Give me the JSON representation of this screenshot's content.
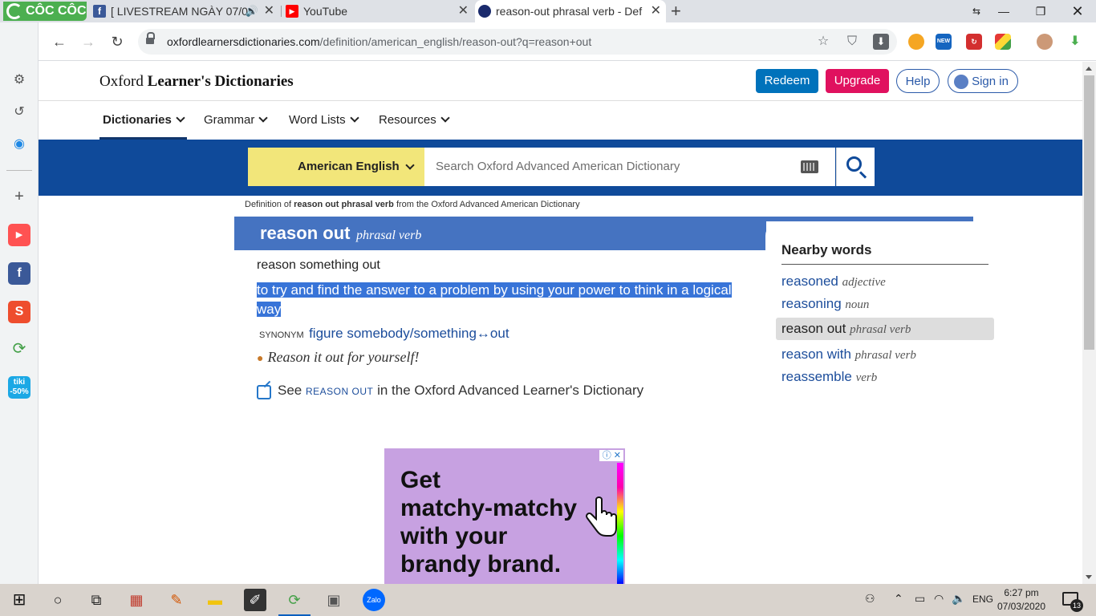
{
  "browser": {
    "brand": "CÔC CÔC",
    "tabs": [
      {
        "title": "[ LIVESTREAM NGÀY 07/0",
        "favicon": "facebook-icon"
      },
      {
        "title": "YouTube",
        "favicon": "youtube-icon"
      },
      {
        "title": "reason-out phrasal verb - Def",
        "favicon": "oxford-icon"
      }
    ],
    "url_domain": "oxfordlearnersdictionaries.com",
    "url_path": "/definition/american_english/reason-out?q=reason+out"
  },
  "site": {
    "logo_regular": "Oxford",
    "logo_bold": "Learner's Dictionaries",
    "buttons": {
      "redeem": "Redeem",
      "upgrade": "Upgrade",
      "help": "Help",
      "signin": "Sign in"
    },
    "menu": [
      "Dictionaries",
      "Grammar",
      "Word Lists",
      "Resources"
    ]
  },
  "search": {
    "dictionary": "American English",
    "placeholder": "Search Oxford Advanced American Dictionary"
  },
  "breadcrumb": {
    "prefix": "Definition of",
    "term": "reason out phrasal verb",
    "suffix": "from the Oxford Advanced American Dictionary"
  },
  "entry": {
    "headword": "reason out",
    "pos": "phrasal verb",
    "phrase": "reason something out",
    "definition_line1": "to try and find the answer to a problem by using your power to think in a logical",
    "definition_line2": "way",
    "synonym_label": "SYNONYM",
    "synonym": "figure somebody/something↔out",
    "example": "Reason it out for yourself!",
    "see_prefix": "See",
    "see_term": "REASON OUT",
    "see_suffix": "in the Oxford Advanced Learner's Dictionary"
  },
  "nearby": {
    "title": "Nearby words",
    "words": [
      {
        "word": "reasoned",
        "pos": "adjective"
      },
      {
        "word": "reasoning",
        "pos": "noun"
      },
      {
        "word": "reason out",
        "pos": "phrasal verb"
      },
      {
        "word": "reason with",
        "pos": "phrasal verb"
      },
      {
        "word": "reassemble",
        "pos": "verb"
      }
    ]
  },
  "ad": {
    "line1": "Get",
    "line2": "matchy-matchy",
    "line3": "with your",
    "line4": "brandy brand."
  },
  "taskbar": {
    "language": "ENG",
    "time": "6:27 pm",
    "date": "07/03/2020",
    "notifications": "13"
  },
  "sidebar": {
    "tiki_label": "tiki",
    "tiki_discount": "-50%"
  }
}
